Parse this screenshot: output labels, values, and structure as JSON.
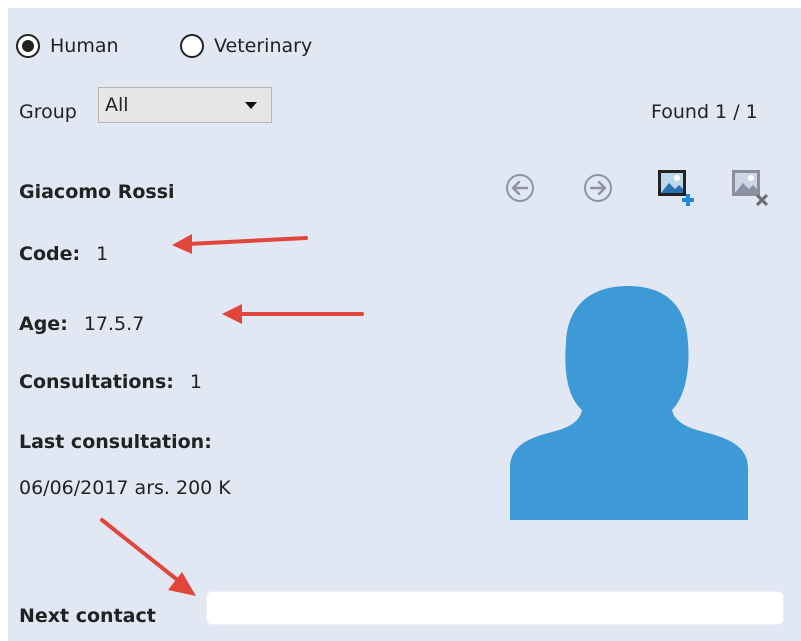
{
  "radios": {
    "human_label": "Human",
    "veterinary_label": "Veterinary",
    "selected": "human"
  },
  "filter": {
    "group_label": "Group",
    "group_value": "All",
    "found_label": "Found 1 / 1"
  },
  "patient": {
    "name": "Giacomo Rossi",
    "code_label": "Code:",
    "code_value": "1",
    "age_label": "Age:",
    "age_value": "17.5.7",
    "consultations_label": "Consultations:",
    "consultations_value": "1",
    "last_consultation_label": "Last consultation:",
    "last_consultation_value": "06/06/2017 ars. 200 K",
    "next_contact_label": "Next contact",
    "next_contact_value": ""
  },
  "icons": {
    "prev": "arrow-left-circle-icon",
    "next": "arrow-right-circle-icon",
    "add_photo": "add-photo-icon",
    "remove_photo": "remove-photo-icon",
    "avatar": "person-silhouette-icon"
  },
  "colors": {
    "panel_bg": "#e2e7f4",
    "avatar": "#3d9ad6",
    "annotation_arrow": "#e0463c",
    "plus_badge": "#1e88e5"
  }
}
